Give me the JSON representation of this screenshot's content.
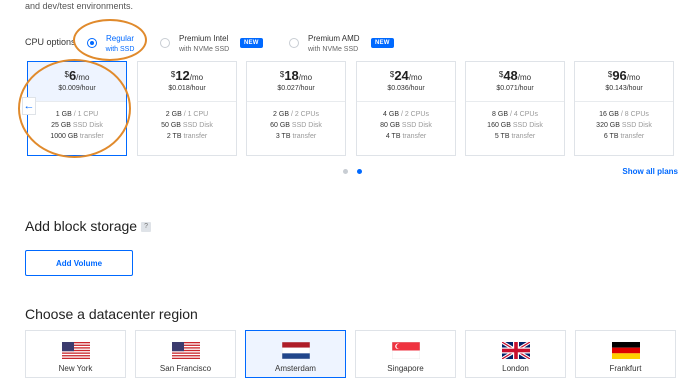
{
  "intro_text": "and dev/test environments.",
  "cpu_options": {
    "label": "CPU options",
    "options": [
      {
        "title": "Regular",
        "subtitle": "with SSD",
        "selected": true
      },
      {
        "title": "Premium Intel",
        "subtitle": "with NVMe SSD",
        "badge": "NEW"
      },
      {
        "title": "Premium AMD",
        "subtitle": "with NVMe SSD",
        "badge": "NEW"
      }
    ]
  },
  "plans": [
    {
      "currency": "$",
      "price": "6",
      "per": "/mo",
      "hourly": "$0.009/hour",
      "memory": "1 GB",
      "cpu": "/ 1 CPU",
      "disk": "25 GB",
      "disk_label": "SSD Disk",
      "transfer": "1000 GB",
      "transfer_label": "transfer",
      "selected": true
    },
    {
      "currency": "$",
      "price": "12",
      "per": "/mo",
      "hourly": "$0.018/hour",
      "memory": "2 GB",
      "cpu": "/ 1 CPU",
      "disk": "50 GB",
      "disk_label": "SSD Disk",
      "transfer": "2 TB",
      "transfer_label": "transfer"
    },
    {
      "currency": "$",
      "price": "18",
      "per": "/mo",
      "hourly": "$0.027/hour",
      "memory": "2 GB",
      "cpu": "/ 2 CPUs",
      "disk": "60 GB",
      "disk_label": "SSD Disk",
      "transfer": "3 TB",
      "transfer_label": "transfer"
    },
    {
      "currency": "$",
      "price": "24",
      "per": "/mo",
      "hourly": "$0.036/hour",
      "memory": "4 GB",
      "cpu": "/ 2 CPUs",
      "disk": "80 GB",
      "disk_label": "SSD Disk",
      "transfer": "4 TB",
      "transfer_label": "transfer"
    },
    {
      "currency": "$",
      "price": "48",
      "per": "/mo",
      "hourly": "$0.071/hour",
      "memory": "8 GB",
      "cpu": "/ 4 CPUs",
      "disk": "160 GB",
      "disk_label": "SSD Disk",
      "transfer": "5 TB",
      "transfer_label": "transfer"
    },
    {
      "currency": "$",
      "price": "96",
      "per": "/mo",
      "hourly": "$0.143/hour",
      "memory": "16 GB",
      "cpu": "/ 8 CPUs",
      "disk": "320 GB",
      "disk_label": "SSD Disk",
      "transfer": "6 TB",
      "transfer_label": "transfer"
    }
  ],
  "carousel": {
    "prev_icon": "arrow-left-icon",
    "prev_glyph": "←",
    "pages": 2,
    "active_page": 2
  },
  "show_all_plans": "Show all plans",
  "block_storage": {
    "title": "Add block storage",
    "help": "?",
    "button": "Add Volume"
  },
  "datacenter": {
    "title": "Choose a datacenter region",
    "regions": [
      {
        "name": "New York",
        "flag": "us-flag"
      },
      {
        "name": "San Francisco",
        "flag": "us-flag"
      },
      {
        "name": "Amsterdam",
        "flag": "nl-flag",
        "selected": true
      },
      {
        "name": "Singapore",
        "flag": "sg-flag"
      },
      {
        "name": "London",
        "flag": "uk-flag"
      },
      {
        "name": "Frankfurt",
        "flag": "de-flag"
      }
    ]
  },
  "colors": {
    "accent": "#0069ff",
    "annotation": "#e08a2c"
  }
}
